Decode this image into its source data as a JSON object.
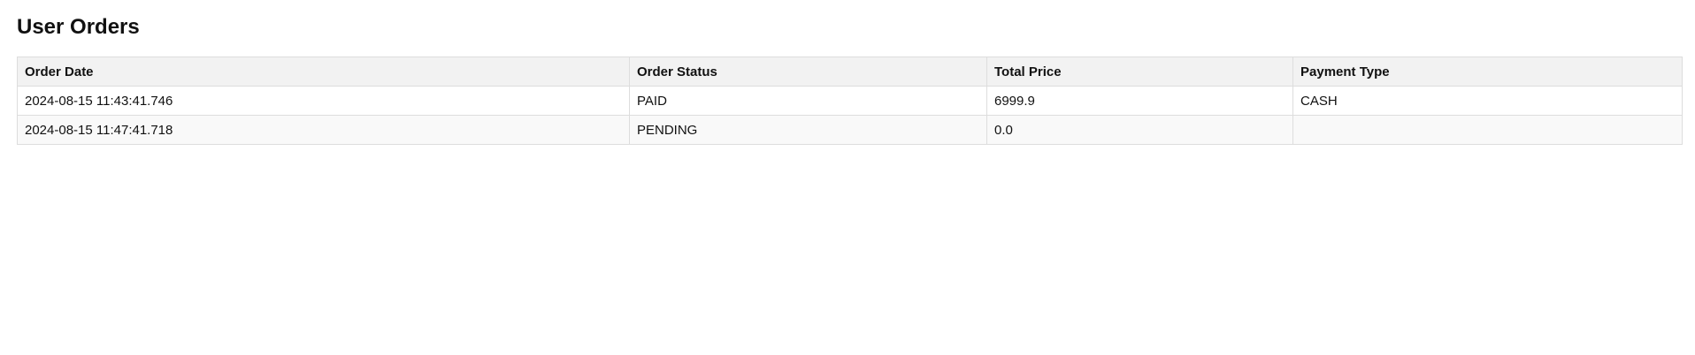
{
  "page": {
    "title": "User Orders"
  },
  "table": {
    "headers": [
      "Order Date",
      "Order Status",
      "Total Price",
      "Payment Type"
    ],
    "rows": [
      [
        "2024-08-15 11:43:41.746",
        "PAID",
        "6999.9",
        "CASH"
      ],
      [
        "2024-08-15 11:47:41.718",
        "PENDING",
        "0.0",
        ""
      ]
    ]
  },
  "colors": {
    "header_background": "#f2f2f2",
    "alt_row_background": "#f9f9f9",
    "border": "#dddddd"
  }
}
